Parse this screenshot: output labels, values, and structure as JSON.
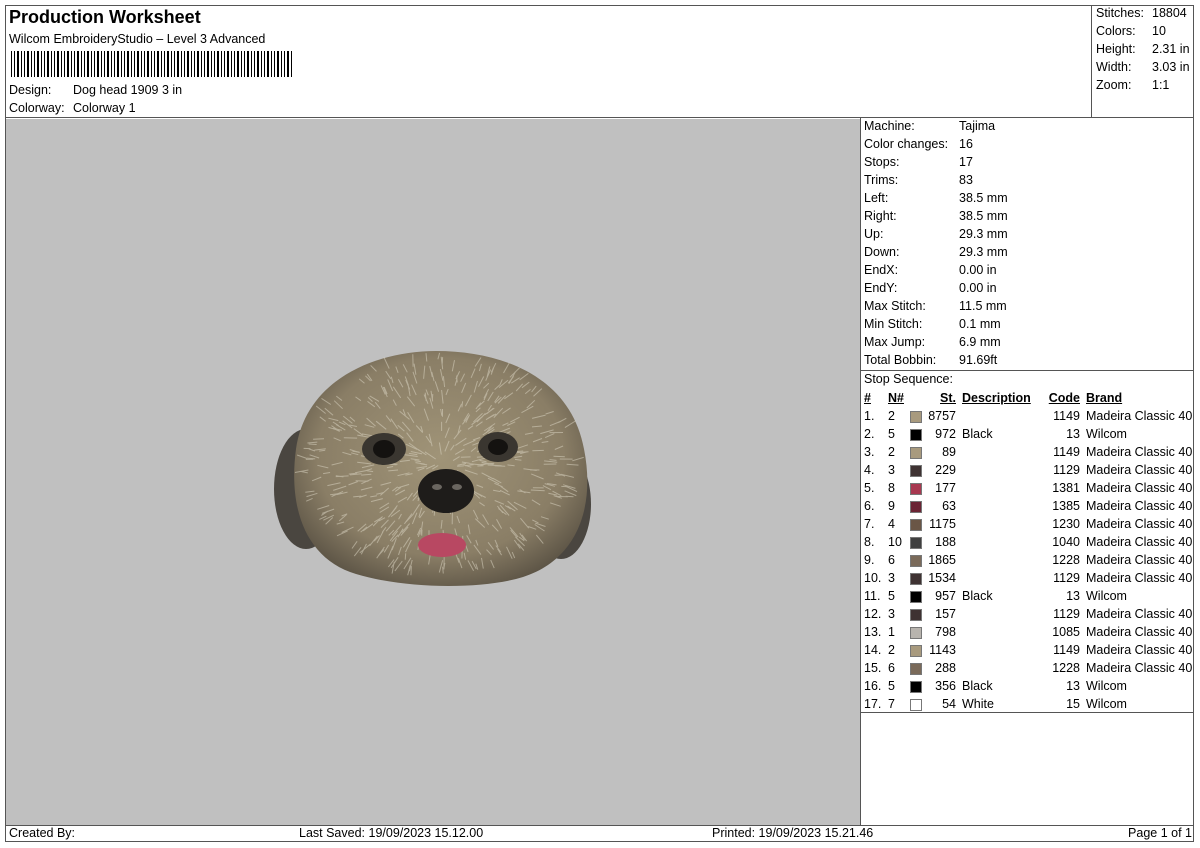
{
  "header": {
    "title": "Production Worksheet",
    "software": "Wilcom EmbroideryStudio – Level 3 Advanced",
    "design_label": "Design:",
    "design_value": "Dog head 1909 3 in",
    "colorway_label": "Colorway:",
    "colorway_value": "Colorway 1"
  },
  "stats": [
    {
      "label": "Stitches:",
      "value": "18804"
    },
    {
      "label": "Colors:",
      "value": "10"
    },
    {
      "label": "Height:",
      "value": "2.31 in"
    },
    {
      "label": "Width:",
      "value": "3.03 in"
    },
    {
      "label": "Zoom:",
      "value": "1:1"
    }
  ],
  "machine_info": [
    {
      "label": "Machine:",
      "value": "Tajima"
    },
    {
      "label": "Color changes:",
      "value": "16"
    },
    {
      "label": "Stops:",
      "value": "17"
    },
    {
      "label": "Trims:",
      "value": "83"
    },
    {
      "label": "Left:",
      "value": "38.5 mm"
    },
    {
      "label": "Right:",
      "value": "38.5 mm"
    },
    {
      "label": "Up:",
      "value": "29.3 mm"
    },
    {
      "label": "Down:",
      "value": "29.3 mm"
    },
    {
      "label": "EndX:",
      "value": "0.00 in"
    },
    {
      "label": "EndY:",
      "value": "0.00 in"
    },
    {
      "label": "Max Stitch:",
      "value": "11.5 mm"
    },
    {
      "label": "Min Stitch:",
      "value": "0.1 mm"
    },
    {
      "label": "Max Jump:",
      "value": "6.9 mm"
    },
    {
      "label": "Total Bobbin:",
      "value": "91.69ft"
    }
  ],
  "stop_sequence": {
    "title": "Stop Sequence:",
    "columns": {
      "idx": "#",
      "needle": "N#",
      "stitches": "St.",
      "description": "Description",
      "code": "Code",
      "brand": "Brand"
    },
    "rows": [
      {
        "idx": "1.",
        "needle": "2",
        "color": "#a89a7e",
        "stitches": "8757",
        "description": "",
        "code": "1149",
        "brand": "Madeira Classic 40"
      },
      {
        "idx": "2.",
        "needle": "5",
        "color": "#000000",
        "stitches": "972",
        "description": "Black",
        "code": "13",
        "brand": "Wilcom"
      },
      {
        "idx": "3.",
        "needle": "2",
        "color": "#a89a7e",
        "stitches": "89",
        "description": "",
        "code": "1149",
        "brand": "Madeira Classic 40"
      },
      {
        "idx": "4.",
        "needle": "3",
        "color": "#3e3232",
        "stitches": "229",
        "description": "",
        "code": "1129",
        "brand": "Madeira Classic 40"
      },
      {
        "idx": "5.",
        "needle": "8",
        "color": "#a83850",
        "stitches": "177",
        "description": "",
        "code": "1381",
        "brand": "Madeira Classic 40"
      },
      {
        "idx": "6.",
        "needle": "9",
        "color": "#6a2434",
        "stitches": "63",
        "description": "",
        "code": "1385",
        "brand": "Madeira Classic 40"
      },
      {
        "idx": "7.",
        "needle": "4",
        "color": "#6a5646",
        "stitches": "1175",
        "description": "",
        "code": "1230",
        "brand": "Madeira Classic 40"
      },
      {
        "idx": "8.",
        "needle": "10",
        "color": "#404040",
        "stitches": "188",
        "description": "",
        "code": "1040",
        "brand": "Madeira Classic 40"
      },
      {
        "idx": "9.",
        "needle": "6",
        "color": "#7a6a5a",
        "stitches": "1865",
        "description": "",
        "code": "1228",
        "brand": "Madeira Classic 40"
      },
      {
        "idx": "10.",
        "needle": "3",
        "color": "#3e3232",
        "stitches": "1534",
        "description": "",
        "code": "1129",
        "brand": "Madeira Classic 40"
      },
      {
        "idx": "11.",
        "needle": "5",
        "color": "#000000",
        "stitches": "957",
        "description": "Black",
        "code": "13",
        "brand": "Wilcom"
      },
      {
        "idx": "12.",
        "needle": "3",
        "color": "#3e3232",
        "stitches": "157",
        "description": "",
        "code": "1129",
        "brand": "Madeira Classic 40"
      },
      {
        "idx": "13.",
        "needle": "1",
        "color": "#b8b4ae",
        "stitches": "798",
        "description": "",
        "code": "1085",
        "brand": "Madeira Classic 40"
      },
      {
        "idx": "14.",
        "needle": "2",
        "color": "#a89a7e",
        "stitches": "1143",
        "description": "",
        "code": "1149",
        "brand": "Madeira Classic 40"
      },
      {
        "idx": "15.",
        "needle": "6",
        "color": "#7a6a5a",
        "stitches": "288",
        "description": "",
        "code": "1228",
        "brand": "Madeira Classic 40"
      },
      {
        "idx": "16.",
        "needle": "5",
        "color": "#000000",
        "stitches": "356",
        "description": "Black",
        "code": "13",
        "brand": "Wilcom"
      },
      {
        "idx": "17.",
        "needle": "7",
        "color": "#ffffff",
        "stitches": "54",
        "description": "White",
        "code": "15",
        "brand": "Wilcom"
      }
    ]
  },
  "footer": {
    "created_by": "Created By:",
    "last_saved": "Last Saved: 19/09/2023 15.12.00",
    "printed": "Printed: 19/09/2023 15.21.46",
    "page": "Page 1 of 1"
  },
  "colors": {
    "preview_bg": "#c0c0c0",
    "border": "#555555"
  }
}
